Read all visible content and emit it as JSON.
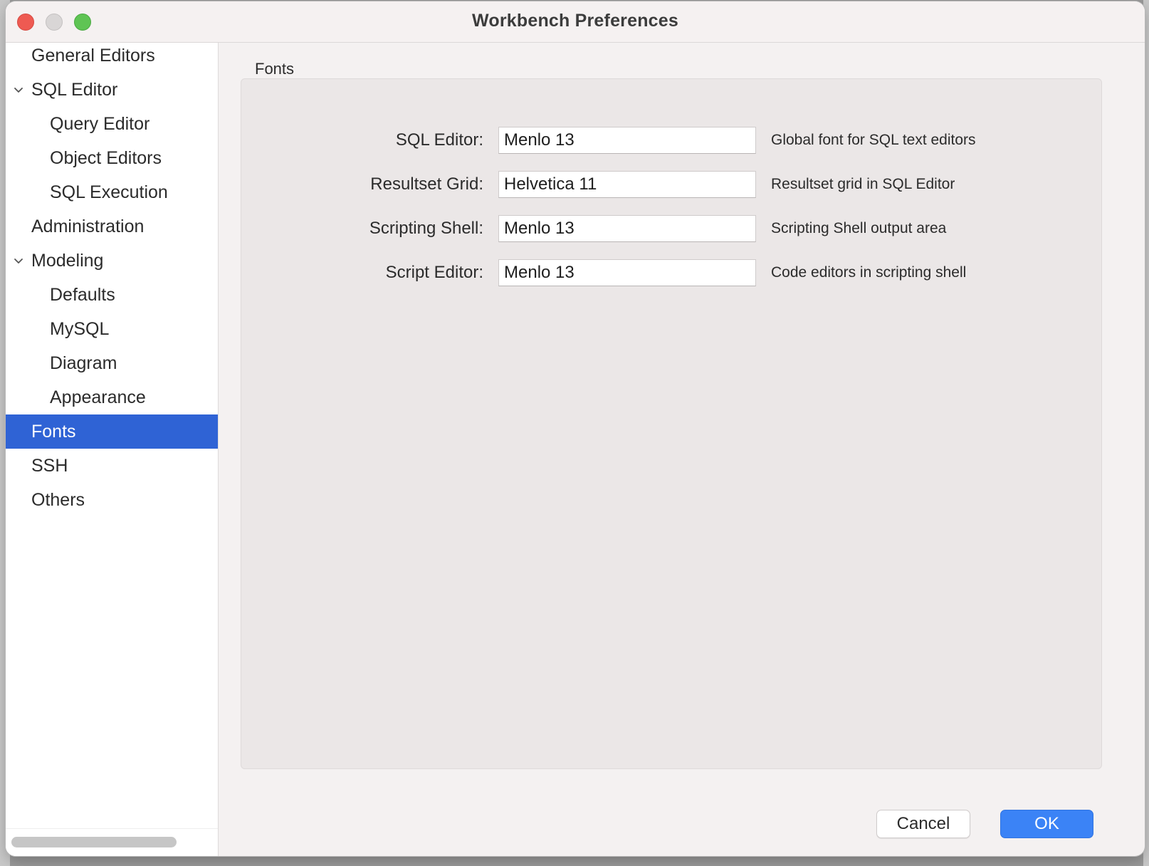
{
  "window": {
    "title": "Workbench Preferences"
  },
  "sidebar": {
    "items": [
      {
        "label": "General Editors",
        "level": 0,
        "expandable": false,
        "selected": false
      },
      {
        "label": "SQL Editor",
        "level": 0,
        "expandable": true,
        "selected": false
      },
      {
        "label": "Query Editor",
        "level": 1,
        "expandable": false,
        "selected": false
      },
      {
        "label": "Object Editors",
        "level": 1,
        "expandable": false,
        "selected": false
      },
      {
        "label": "SQL Execution",
        "level": 1,
        "expandable": false,
        "selected": false
      },
      {
        "label": "Administration",
        "level": 0,
        "expandable": false,
        "selected": false
      },
      {
        "label": "Modeling",
        "level": 0,
        "expandable": true,
        "selected": false
      },
      {
        "label": "Defaults",
        "level": 1,
        "expandable": false,
        "selected": false
      },
      {
        "label": "MySQL",
        "level": 1,
        "expandable": false,
        "selected": false
      },
      {
        "label": "Diagram",
        "level": 1,
        "expandable": false,
        "selected": false
      },
      {
        "label": "Appearance",
        "level": 1,
        "expandable": false,
        "selected": false
      },
      {
        "label": "Fonts",
        "level": 0,
        "expandable": false,
        "selected": true
      },
      {
        "label": "SSH",
        "level": 0,
        "expandable": false,
        "selected": false
      },
      {
        "label": "Others",
        "level": 0,
        "expandable": false,
        "selected": false
      }
    ]
  },
  "fonts_panel": {
    "group_label": "Fonts",
    "rows": [
      {
        "label": "SQL Editor:",
        "value": "Menlo 13",
        "description": "Global font for SQL text editors"
      },
      {
        "label": "Resultset Grid:",
        "value": "Helvetica 11",
        "description": "Resultset grid in SQL Editor"
      },
      {
        "label": "Scripting Shell:",
        "value": "Menlo 13",
        "description": "Scripting Shell output area"
      },
      {
        "label": "Script Editor:",
        "value": "Menlo 13",
        "description": "Code editors in scripting shell"
      }
    ]
  },
  "buttons": {
    "cancel": "Cancel",
    "ok": "OK"
  },
  "colors": {
    "selection": "#2f63d5",
    "primary_button": "#3b83f6",
    "close": "#ee5a52",
    "zoom": "#5fc454"
  },
  "icons": {
    "expand": "chevron-down-icon"
  }
}
